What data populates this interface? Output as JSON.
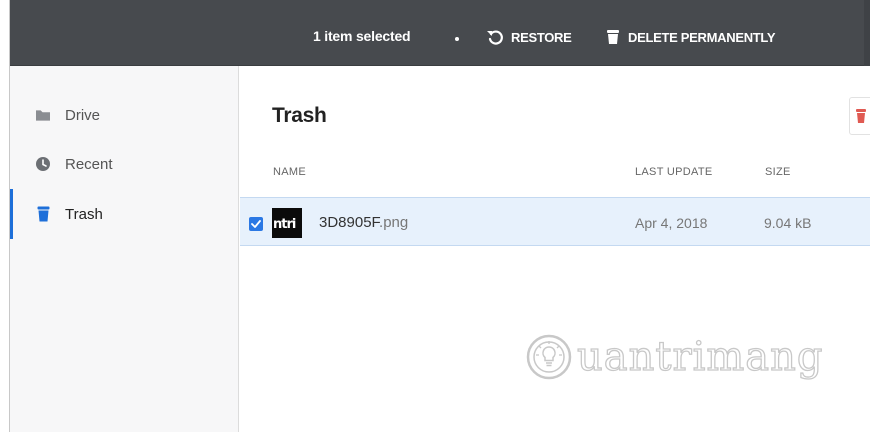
{
  "toolbar": {
    "selection_count": "1 item selected",
    "restore_label": "RESTORE",
    "delete_label": "DELETE PERMANENTLY"
  },
  "sidebar": {
    "items": [
      {
        "label": "Drive",
        "icon": "folder-icon"
      },
      {
        "label": "Recent",
        "icon": "clock-icon"
      },
      {
        "label": "Trash",
        "icon": "trash-icon",
        "active": true
      }
    ]
  },
  "main": {
    "title": "Trash",
    "columns": {
      "name": "NAME",
      "last_update": "LAST UPDATE",
      "size": "SIZE"
    },
    "files": [
      {
        "thumb_text": "ntri",
        "name": "3D8905F",
        "ext": ".png",
        "last_update": "Apr 4, 2018",
        "size": "9.04 kB",
        "selected": true
      }
    ]
  },
  "watermark": {
    "text": "uantrimang"
  },
  "colors": {
    "topbar": "#474a4e",
    "accent": "#2b78e4",
    "selected_row": "#e7f1fc",
    "sidebar_bg": "#f7f7f8",
    "delete_red": "#e05a52"
  }
}
